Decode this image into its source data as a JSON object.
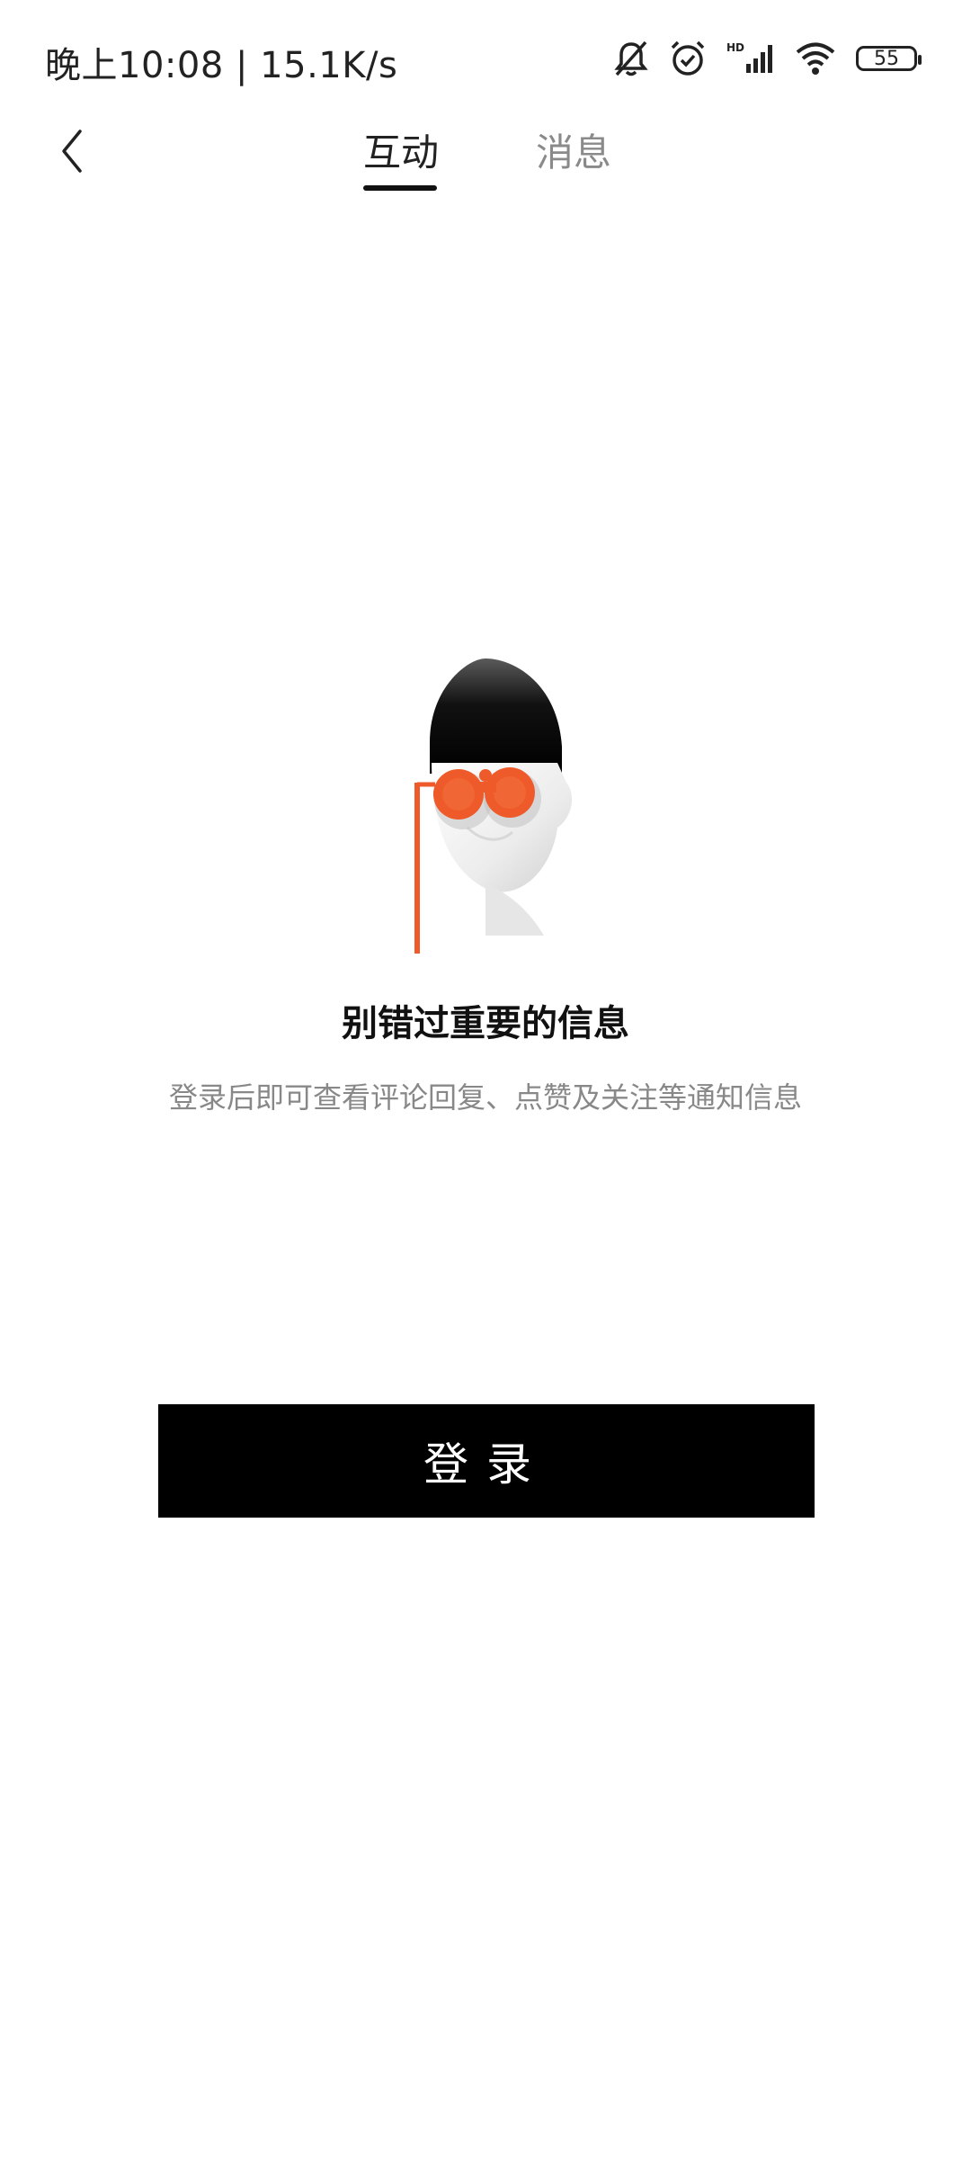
{
  "status_bar": {
    "time_speed": "晚上10:08 | 15.1K/s",
    "battery": "55",
    "icons": [
      "muted-bell-icon",
      "alarm-icon",
      "hd-signal-icon",
      "wifi-icon",
      "battery-icon"
    ]
  },
  "nav": {
    "back_icon": "chevron-left-icon",
    "tabs": [
      {
        "label": "互动",
        "active": true
      },
      {
        "label": "消息",
        "active": false
      }
    ]
  },
  "empty_state": {
    "illustration": "binoculars-head-illustration",
    "title": "别错过重要的信息",
    "subtitle": "登录后即可查看评论回复、点赞及关注等通知信息"
  },
  "login_button": {
    "label": "登录"
  },
  "colors": {
    "accent": "#ee5a2a",
    "button_bg": "#000000",
    "inactive_tab": "#8a8a8a"
  }
}
